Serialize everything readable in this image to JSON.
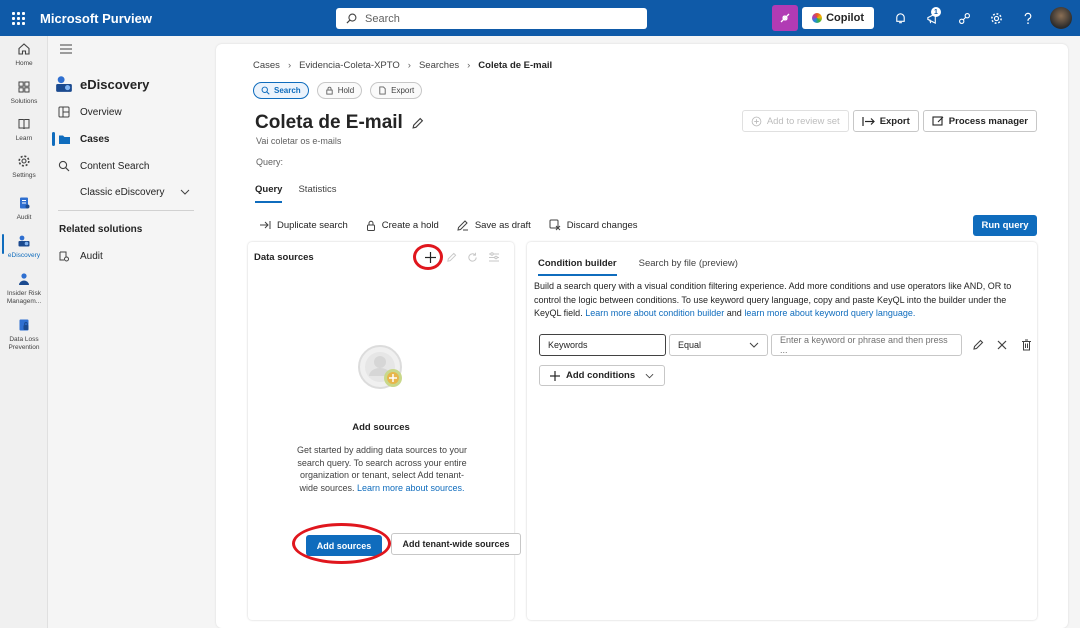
{
  "app": {
    "title": "Microsoft Purview"
  },
  "search": {
    "placeholder": "Search"
  },
  "copilot": {
    "label": "Copilot"
  },
  "notifications": {
    "count": "1"
  },
  "rail": {
    "items": [
      {
        "label": "Home",
        "icon": "home-icon"
      },
      {
        "label": "Solutions",
        "icon": "solutions-icon"
      },
      {
        "label": "Learn",
        "icon": "book-icon"
      },
      {
        "label": "Settings",
        "icon": "gear-icon"
      },
      {
        "label": "Audit",
        "icon": "audit-icon"
      },
      {
        "label": "eDiscovery",
        "icon": "ediscovery-icon"
      },
      {
        "label": "Insider Risk Managem...",
        "icon": "insider-risk-icon"
      },
      {
        "label": "Data Loss Prevention",
        "icon": "dlp-icon"
      }
    ]
  },
  "nav": {
    "title": "eDiscovery",
    "items": [
      {
        "label": "Overview"
      },
      {
        "label": "Cases"
      },
      {
        "label": "Content Search"
      },
      {
        "label": "Classic eDiscovery"
      }
    ],
    "related_header": "Related solutions",
    "related": [
      {
        "label": "Audit"
      }
    ]
  },
  "breadcrumb": [
    "Cases",
    "Evidencia-Coleta-XPTO",
    "Searches",
    "Coleta de E-mail"
  ],
  "pills": [
    "Search",
    "Hold",
    "Export"
  ],
  "page": {
    "title": "Coleta de E-mail",
    "subtitle": "Vai coletar os e-mails",
    "query_label": "Query:"
  },
  "header_buttons": {
    "add_review": "Add to review set",
    "export": "Export",
    "process_manager": "Process manager"
  },
  "tabs": [
    "Query",
    "Statistics"
  ],
  "actions": {
    "duplicate": "Duplicate search",
    "hold": "Create a hold",
    "save": "Save as draft",
    "discard": "Discard changes",
    "run": "Run query"
  },
  "data_sources": {
    "title": "Data sources",
    "empty_title": "Add sources",
    "empty_text": "Get started by adding data sources to your search query. To search across your entire organization or tenant, select Add tenant-wide sources. ",
    "empty_link": "Learn more about sources.",
    "add_button": "Add sources",
    "tenant_button": "Add tenant-wide sources"
  },
  "condition": {
    "tabs": [
      "Condition builder",
      "Search by file (preview)"
    ],
    "desc": "Build a search query with a visual condition filtering experience. Add more conditions and use operators like AND, OR to control the logic between conditions. To use keyword query language, copy and paste KeyQL into the builder under the KeyQL field. ",
    "link1": "Learn more about condition builder",
    "and_text": " and ",
    "link2": "learn more about keyword query language.",
    "field": "Keywords",
    "operator": "Equal",
    "value_placeholder": "Enter a keyword or phrase and then press ...",
    "add_conditions": "Add conditions"
  },
  "colors": {
    "accent": "#0f6cbd",
    "topbar": "#0f5aa8",
    "highlight_ring": "#e0161d"
  }
}
